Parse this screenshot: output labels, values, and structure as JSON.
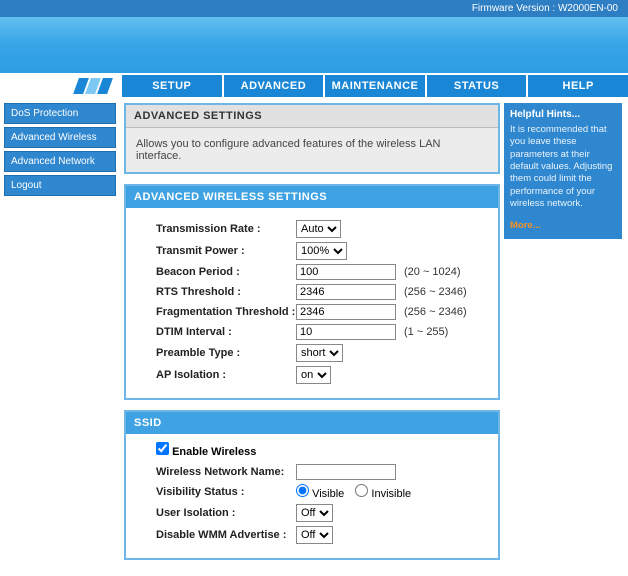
{
  "firmware_label": "Firmware Version : W2000EN-00",
  "tabs": [
    "SETUP",
    "ADVANCED",
    "MAINTENANCE",
    "STATUS",
    "HELP"
  ],
  "sidebar": {
    "items": [
      "DoS Protection",
      "Advanced Wireless",
      "Advanced Network",
      "Logout"
    ]
  },
  "panel1": {
    "title": "ADVANCED SETTINGS",
    "desc": "Allows you to configure advanced features of the wireless LAN interface."
  },
  "panel2": {
    "title": "ADVANCED WIRELESS SETTINGS",
    "rows": {
      "tx_rate_label": "Transmission Rate :",
      "tx_rate_value": "Auto",
      "tx_power_label": "Transmit Power :",
      "tx_power_value": "100%",
      "beacon_label": "Beacon Period :",
      "beacon_value": "100",
      "beacon_range": "(20 ~ 1024)",
      "rts_label": "RTS Threshold :",
      "rts_value": "2346",
      "rts_range": "(256 ~ 2346)",
      "frag_label": "Fragmentation Threshold :",
      "frag_value": "2346",
      "frag_range": "(256 ~ 2346)",
      "dtim_label": "DTIM Interval :",
      "dtim_value": "10",
      "dtim_range": "(1 ~ 255)",
      "preamble_label": "Preamble Type :",
      "preamble_value": "short",
      "apiso_label": "AP Isolation :",
      "apiso_value": "on"
    }
  },
  "panel3": {
    "title": "SSID",
    "enable_label": "Enable Wireless",
    "nn_label": "Wireless Network Name:",
    "nn_value": "",
    "vis_label": "Visibility Status :",
    "vis_visible": "Visible",
    "vis_invisible": "Invisible",
    "useriso_label": "User Isolation :",
    "useriso_value": "Off",
    "wmm_label": "Disable WMM Advertise :",
    "wmm_value": "Off"
  },
  "hints": {
    "title": "Helpful Hints...",
    "body": "It is recommended that you leave these parameters at their default values. Adjusting them could limit the performance of your wireless network.",
    "more": "More..."
  }
}
